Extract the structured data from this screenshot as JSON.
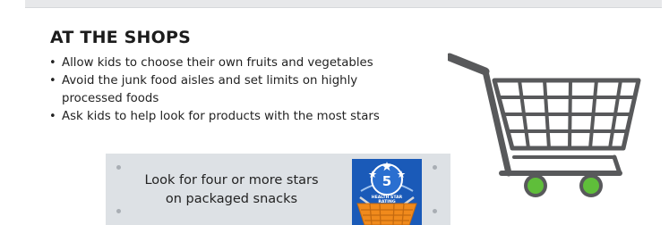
{
  "section": {
    "heading": "AT THE SHOPS",
    "tips": [
      {
        "bullet": "•",
        "text": "Allow kids to choose their own fruits and vegetables"
      },
      {
        "bullet": "•",
        "text": "Avoid the junk food aisles and set limits on highly processed foods"
      },
      {
        "bullet": "•",
        "text": "Ask kids to help look for products with the most stars"
      }
    ]
  },
  "callout": {
    "line1": "Look for four or more stars",
    "line2": "on packaged snacks"
  },
  "badge": {
    "icon": "health-star-rating-basket-icon",
    "rating": "5",
    "caption_top": "HEALTH STAR",
    "caption_bottom": "RATING"
  },
  "cart": {
    "icon": "shopping-cart-icon",
    "wheel_color": "#5fbe3a"
  },
  "colors": {
    "callout_bg": "#dde1e5",
    "badge_blue": "#1a5ab8",
    "basket_orange": "#f08a1c",
    "cart_gray": "#58595b"
  }
}
